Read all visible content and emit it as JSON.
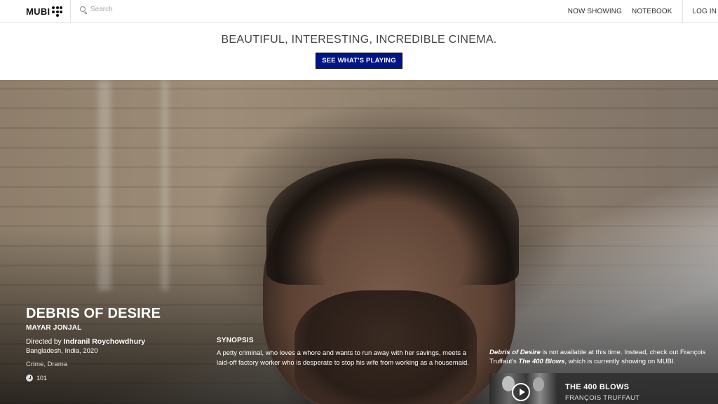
{
  "header": {
    "logo_text": "MUBI",
    "search_placeholder": "Search",
    "nav": [
      "NOW SHOWING",
      "NOTEBOOK"
    ],
    "login_label": "LOG IN"
  },
  "promo": {
    "tagline": "BEAUTIFUL, INTERESTING, INCREDIBLE CINEMA.",
    "cta_label": "SEE WHAT'S PLAYING",
    "cta_color": "#001489"
  },
  "film": {
    "title": "DEBRIS OF DESIRE",
    "alt_title": "MAYAR JONJAL",
    "directed_by_prefix": "Directed by",
    "director": "Indranil Roychowdhury",
    "meta": "Bangladesh, India, 2020",
    "genres": "Crime, Drama",
    "runtime": "101"
  },
  "synopsis": {
    "heading": "SYNOPSIS",
    "text": "A petty criminal, who loves a whore and wants to run away with her savings, meets a laid-off factory worker who is desperate to stop his wife from working as a housemaid."
  },
  "availability": {
    "film_title": "Debris of Desire",
    "text_1": " is not available at this time. Instead, check out François Truffaut's ",
    "alt_title": "The 400 Blows",
    "text_2": ", which is currently showing on MUBI."
  },
  "recommendation": {
    "title": "THE 400 BLOWS",
    "director": "FRANÇOIS TRUFFAUT"
  }
}
